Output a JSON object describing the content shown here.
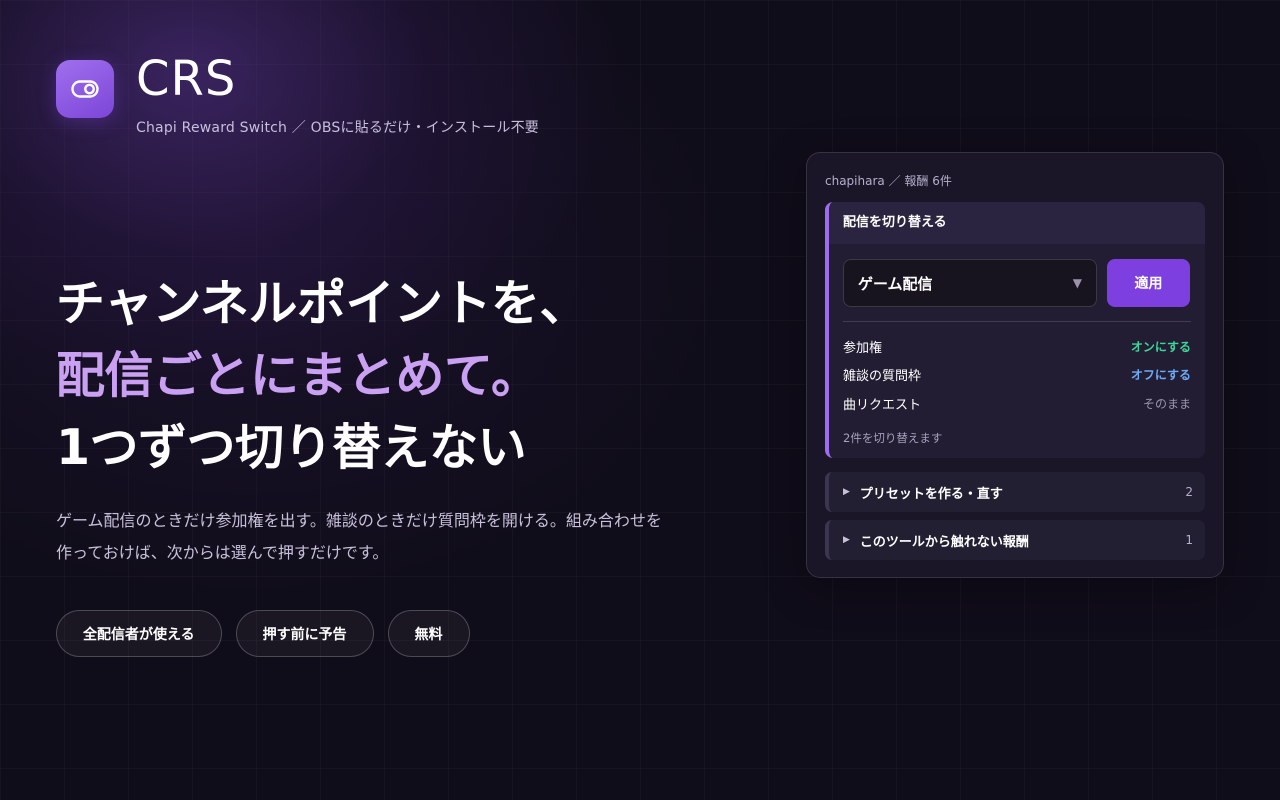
{
  "brand": {
    "icon": "toggle-switch-icon",
    "title": "CRS",
    "subtitle": "Chapi Reward Switch ／ OBSに貼るだけ・インストール不要"
  },
  "hero": {
    "heading_line1": "チャンネルポイントを、",
    "heading_line2": "配信ごとにまとめて。",
    "heading_line3": "1つずつ切り替えない",
    "description": "ゲーム配信のときだけ参加権を出す。雑談のときだけ質問枠を開ける。組み合わせを作っておけば、次からは選んで押すだけです。"
  },
  "pills": [
    {
      "label": "全配信者が使える"
    },
    {
      "label": "押す前に予告"
    },
    {
      "label": "無料"
    }
  ],
  "panel": {
    "header": "chapihara ／ 報酬 6件",
    "switch": {
      "title": "配信を切り替える",
      "selected_preset": "ゲーム配信",
      "apply_label": "適用",
      "changes": [
        {
          "name": "参加権",
          "action": "オンにする",
          "status": "on"
        },
        {
          "name": "雑談の質問枠",
          "action": "オフにする",
          "status": "off"
        },
        {
          "name": "曲リクエスト",
          "action": "そのまま",
          "status": "keep"
        }
      ],
      "summary": "2件を切り替えます"
    },
    "sections": [
      {
        "label": "プリセットを作る・直す",
        "count": "2"
      },
      {
        "label": "このツールから触れない報酬",
        "count": "1"
      }
    ]
  },
  "colors": {
    "background": "#100d1a",
    "accent": "#7d3fe0",
    "accent_light": "#c9a0f2",
    "on": "#3ed598",
    "off": "#6eaaf5"
  }
}
